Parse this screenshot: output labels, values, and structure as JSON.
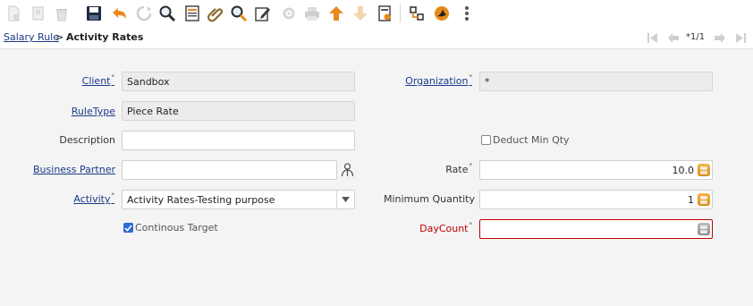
{
  "toolbar": {
    "buttons": [
      {
        "name": "new-record-button",
        "icon": "new-document-icon"
      },
      {
        "name": "copy-record-button",
        "icon": "copy-icon"
      },
      {
        "name": "delete-button",
        "icon": "trash-icon"
      },
      {
        "name": "save-button",
        "icon": "floppy-disk-icon"
      },
      {
        "name": "undo-button",
        "icon": "undo-arrow-icon"
      },
      {
        "name": "refresh-button",
        "icon": "refresh-icon"
      },
      {
        "name": "find-button",
        "icon": "magnifier-icon"
      },
      {
        "name": "form-view-button",
        "icon": "form-icon"
      },
      {
        "name": "attachment-button",
        "icon": "paperclip-icon"
      },
      {
        "name": "zoom-across-button",
        "icon": "zoom-icon"
      },
      {
        "name": "notes-button",
        "icon": "pencil-note-icon"
      },
      {
        "name": "workflow-button",
        "icon": "gear-workflow-icon"
      },
      {
        "name": "print-button",
        "icon": "printer-icon"
      },
      {
        "name": "previous-record-button",
        "icon": "arrow-up-icon"
      },
      {
        "name": "next-record-button",
        "icon": "arrow-down-icon"
      },
      {
        "name": "report-button",
        "icon": "report-icon"
      },
      {
        "name": "archive-button",
        "icon": "archive-icon"
      },
      {
        "name": "help-button",
        "icon": "help-icon"
      },
      {
        "name": "more-button",
        "icon": "vertical-dots-icon"
      }
    ]
  },
  "breadcrumb": {
    "parent": "Salary Rule",
    "separator": ">",
    "current": "Activity Rates",
    "record_count": "*1/1"
  },
  "form": {
    "client": {
      "label": "Client",
      "value": "Sandbox"
    },
    "organization": {
      "label": "Organization",
      "value": "*"
    },
    "rule_type": {
      "label": "RuleType",
      "value": "Piece Rate"
    },
    "description": {
      "label": "Description",
      "value": ""
    },
    "deduct_min_qty": {
      "label": "Deduct Min Qty",
      "checked": false
    },
    "business_partner": {
      "label": "Business Partner",
      "value": ""
    },
    "rate": {
      "label": "Rate",
      "value": "10.0"
    },
    "activity": {
      "label": "Activity",
      "value": "Activity Rates-Testing purpose"
    },
    "minimum_quantity": {
      "label": "Minimum Quantity",
      "value": "1"
    },
    "continous_target": {
      "label": "Continous Target",
      "checked": true
    },
    "day_count": {
      "label": "DayCount",
      "value": ""
    }
  },
  "colors": {
    "link": "#1a3a8a",
    "error": "#c00000",
    "accent_orange": "#e8891a",
    "checkbox_checked": "#2a6ad6"
  }
}
